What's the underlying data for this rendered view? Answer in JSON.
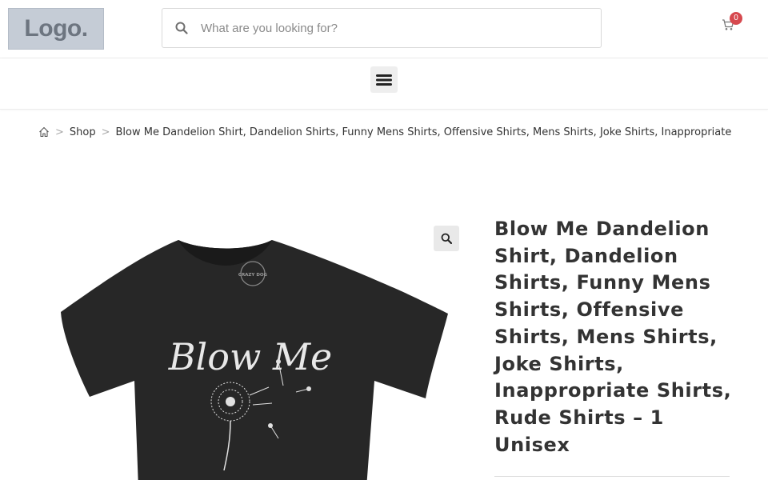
{
  "header": {
    "logo_text": "Logo.",
    "search_placeholder": "What are you looking for?",
    "cart_count": "0"
  },
  "breadcrumb": {
    "home_icon": "home-icon",
    "separator": ">",
    "shop_label": "Shop",
    "current_label": "Blow Me Dandelion Shirt, Dandelion Shirts, Funny Mens Shirts, Offensive Shirts, Mens Shirts, Joke Shirts, Inappropriate"
  },
  "product": {
    "title": "Blow Me Dandelion Shirt, Dandelion Shirts, Funny Mens Shirts, Offensive Shirts, Mens Shirts, Joke Shirts, Inappropriate Shirts, Rude Shirts – 1 Unisex",
    "shirt_print": "Blow Me",
    "tag_text": "CRAZY DOG"
  },
  "icons": [
    "search-icon",
    "cart-icon",
    "menu-icon",
    "home-icon",
    "zoom-icon"
  ],
  "colors": {
    "badge": "#d6494f",
    "shirt": "#2b2b2b",
    "print": "#e8e8e8"
  }
}
